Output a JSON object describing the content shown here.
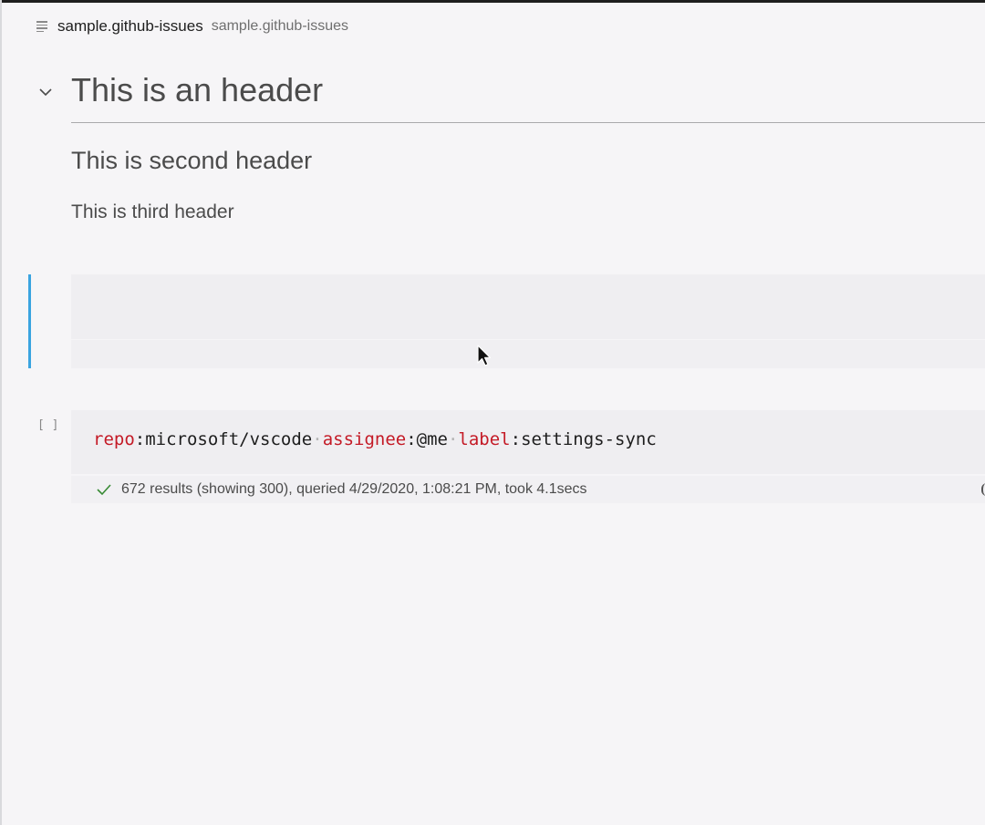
{
  "breadcrumb": {
    "icon": "list-icon",
    "name": "sample.github-issues",
    "description": "sample.github-issues"
  },
  "markdown_cell": {
    "collapse_icon": "chevron-down-icon",
    "h1": "This is an header",
    "h2": "This is second header",
    "h3": "This is third header"
  },
  "empty_cell": {
    "focused": true,
    "accent_color": "#3aa4e0"
  },
  "code_cell": {
    "execution_count": "[ ]",
    "query": [
      {
        "type": "keyword",
        "text": "repo"
      },
      {
        "type": "text",
        "text": ":microsoft/vscode"
      },
      {
        "type": "space",
        "text": "·"
      },
      {
        "type": "keyword",
        "text": "assignee"
      },
      {
        "type": "text",
        "text": ":@me"
      },
      {
        "type": "space",
        "text": "·"
      },
      {
        "type": "keyword",
        "text": "label"
      },
      {
        "type": "text",
        "text": ":settings-sync"
      }
    ],
    "status_icon": "check-icon",
    "status_text": "672 results (showing 300), queried 4/29/2020, 1:08:21 PM, took 4.1secs"
  },
  "colors": {
    "keyword": "#c41a26",
    "success": "#388a34",
    "background": "#f6f5f7"
  }
}
